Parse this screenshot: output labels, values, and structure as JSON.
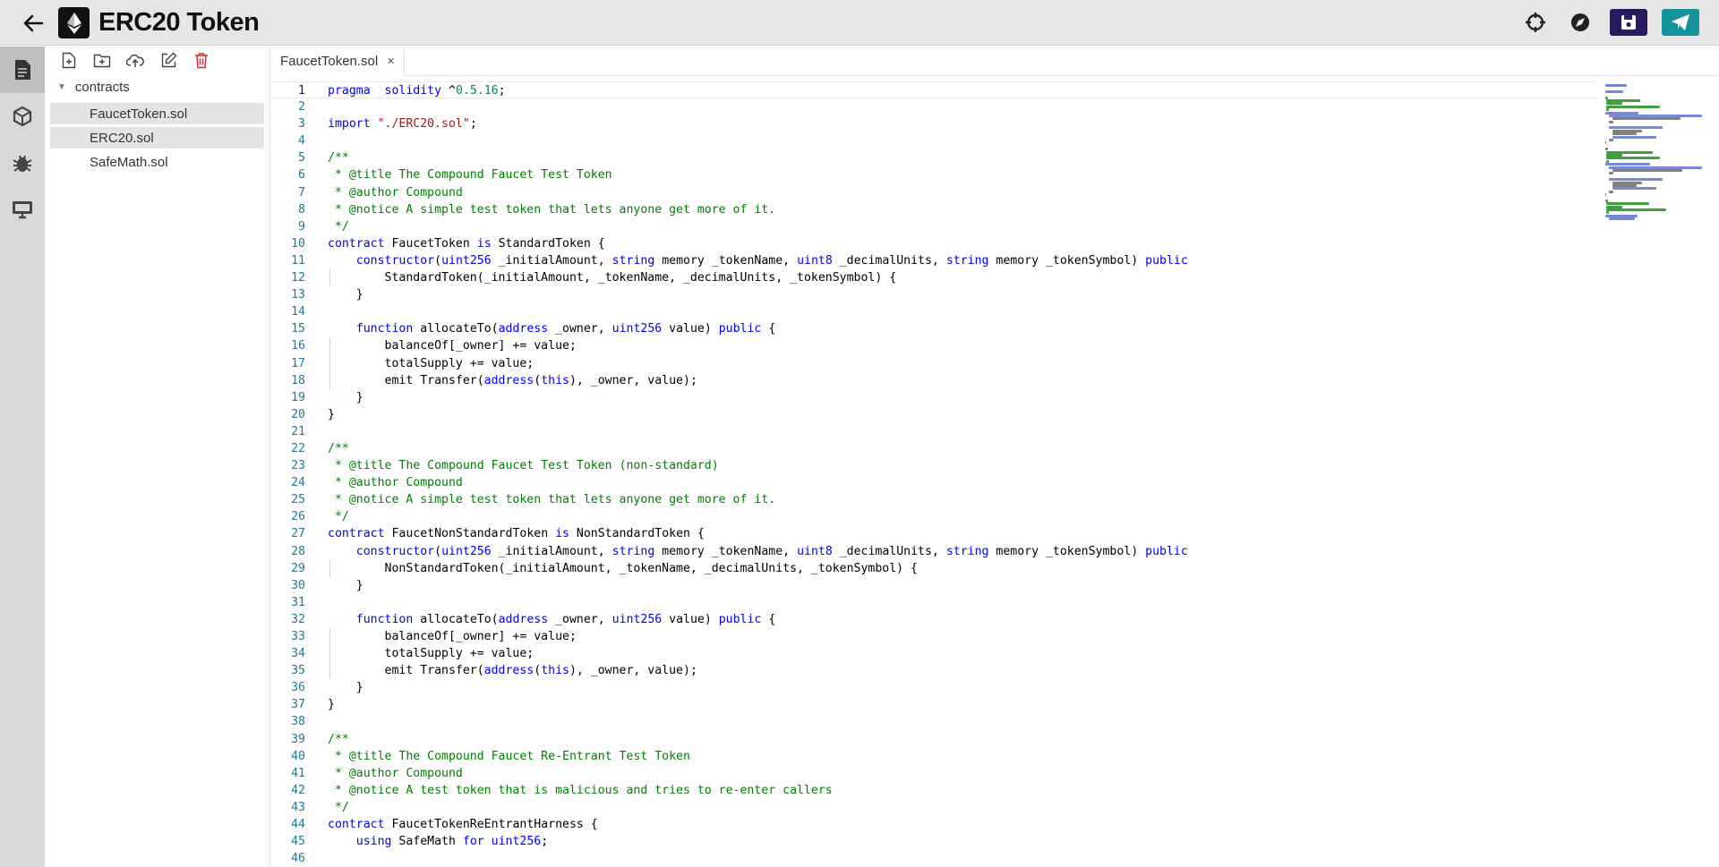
{
  "app": {
    "title": "ERC20 Token"
  },
  "topbar": {
    "icons": [
      "back-arrow-icon",
      "ethereum-logo",
      "crosshair-icon",
      "compass-icon",
      "save-icon",
      "send-icon"
    ]
  },
  "rail": {
    "items": [
      "file-explorer-icon",
      "compiler-icon",
      "debugger-icon",
      "terminal-icon"
    ]
  },
  "explorer": {
    "toolbar": [
      "new-file-icon",
      "new-folder-icon",
      "upload-icon",
      "rename-icon",
      "delete-icon"
    ],
    "folder": "contracts",
    "files": [
      {
        "name": "FaucetToken.sol",
        "selected": true
      },
      {
        "name": "ERC20.sol",
        "selected": true
      },
      {
        "name": "SafeMath.sol",
        "selected": false
      }
    ]
  },
  "editor": {
    "tab": {
      "label": "FaucetToken.sol",
      "close": "×"
    },
    "lines": [
      [
        [
          "kw",
          "pragma"
        ],
        [
          "",
          "  "
        ],
        [
          "kw",
          "solidity"
        ],
        [
          "",
          " ^"
        ],
        [
          "num",
          "0.5.16"
        ],
        [
          "",
          ";"
        ]
      ],
      [],
      [
        [
          "kw",
          "import"
        ],
        [
          "",
          " "
        ],
        [
          "str",
          "\"./ERC20.sol\""
        ],
        [
          "",
          ";"
        ]
      ],
      [],
      [
        [
          "cm",
          "/**"
        ]
      ],
      [
        [
          "cm",
          " * @title The Compound Faucet Test Token"
        ]
      ],
      [
        [
          "cm",
          " * @author Compound"
        ]
      ],
      [
        [
          "cm",
          " * @notice A simple test token that lets anyone get more of it."
        ]
      ],
      [
        [
          "cm",
          " */"
        ]
      ],
      [
        [
          "kw",
          "contract"
        ],
        [
          "",
          " FaucetToken "
        ],
        [
          "kw",
          "is"
        ],
        [
          "",
          " StandardToken {"
        ]
      ],
      [
        [
          "",
          "    "
        ],
        [
          "kw",
          "constructor"
        ],
        [
          "",
          "("
        ],
        [
          "ty",
          "uint256"
        ],
        [
          "",
          " _initialAmount, "
        ],
        [
          "ty",
          "string"
        ],
        [
          "",
          " memory _tokenName, "
        ],
        [
          "ty",
          "uint8"
        ],
        [
          "",
          " _decimalUnits, "
        ],
        [
          "ty",
          "string"
        ],
        [
          "",
          " memory _tokenSymbol) "
        ],
        [
          "kw",
          "public"
        ]
      ],
      [
        [
          "",
          "        StandardToken(_initialAmount, _tokenName, _decimalUnits, _tokenSymbol) {"
        ]
      ],
      [
        [
          "",
          "    }"
        ]
      ],
      [],
      [
        [
          "",
          "    "
        ],
        [
          "kw",
          "function"
        ],
        [
          "",
          " allocateTo("
        ],
        [
          "ty",
          "address"
        ],
        [
          "",
          " _owner, "
        ],
        [
          "ty",
          "uint256"
        ],
        [
          "",
          " value) "
        ],
        [
          "kw",
          "public"
        ],
        [
          "",
          " {"
        ]
      ],
      [
        [
          "",
          "        balanceOf[_owner] += value;"
        ]
      ],
      [
        [
          "",
          "        totalSupply += value;"
        ]
      ],
      [
        [
          "",
          "        emit Transfer("
        ],
        [
          "ty",
          "address"
        ],
        [
          "",
          "("
        ],
        [
          "kw",
          "this"
        ],
        [
          "",
          "), _owner, value);"
        ]
      ],
      [
        [
          "",
          "    }"
        ]
      ],
      [
        [
          "",
          "}"
        ]
      ],
      [],
      [
        [
          "cm",
          "/**"
        ]
      ],
      [
        [
          "cm",
          " * @title The Compound Faucet Test Token (non-standard)"
        ]
      ],
      [
        [
          "cm",
          " * @author Compound"
        ]
      ],
      [
        [
          "cm",
          " * @notice A simple test token that lets anyone get more of it."
        ]
      ],
      [
        [
          "cm",
          " */"
        ]
      ],
      [
        [
          "kw",
          "contract"
        ],
        [
          "",
          " FaucetNonStandardToken "
        ],
        [
          "kw",
          "is"
        ],
        [
          "",
          " NonStandardToken {"
        ]
      ],
      [
        [
          "",
          "    "
        ],
        [
          "kw",
          "constructor"
        ],
        [
          "",
          "("
        ],
        [
          "ty",
          "uint256"
        ],
        [
          "",
          " _initialAmount, "
        ],
        [
          "ty",
          "string"
        ],
        [
          "",
          " memory _tokenName, "
        ],
        [
          "ty",
          "uint8"
        ],
        [
          "",
          " _decimalUnits, "
        ],
        [
          "ty",
          "string"
        ],
        [
          "",
          " memory _tokenSymbol) "
        ],
        [
          "kw",
          "public"
        ]
      ],
      [
        [
          "",
          "        NonStandardToken(_initialAmount, _tokenName, _decimalUnits, _tokenSymbol) {"
        ]
      ],
      [
        [
          "",
          "    }"
        ]
      ],
      [],
      [
        [
          "",
          "    "
        ],
        [
          "kw",
          "function"
        ],
        [
          "",
          " allocateTo("
        ],
        [
          "ty",
          "address"
        ],
        [
          "",
          " _owner, "
        ],
        [
          "ty",
          "uint256"
        ],
        [
          "",
          " value) "
        ],
        [
          "kw",
          "public"
        ],
        [
          "",
          " {"
        ]
      ],
      [
        [
          "",
          "        balanceOf[_owner] += value;"
        ]
      ],
      [
        [
          "",
          "        totalSupply += value;"
        ]
      ],
      [
        [
          "",
          "        emit Transfer("
        ],
        [
          "ty",
          "address"
        ],
        [
          "",
          "("
        ],
        [
          "kw",
          "this"
        ],
        [
          "",
          "), _owner, value);"
        ]
      ],
      [
        [
          "",
          "    }"
        ]
      ],
      [
        [
          "",
          "}"
        ]
      ],
      [],
      [
        [
          "cm",
          "/**"
        ]
      ],
      [
        [
          "cm",
          " * @title The Compound Faucet Re-Entrant Test Token"
        ]
      ],
      [
        [
          "cm",
          " * @author Compound"
        ]
      ],
      [
        [
          "cm",
          " * @notice A test token that is malicious and tries to re-enter callers"
        ]
      ],
      [
        [
          "cm",
          " */"
        ]
      ],
      [
        [
          "kw",
          "contract"
        ],
        [
          "",
          " FaucetTokenReEntrantHarness {"
        ]
      ],
      [
        [
          "",
          "    "
        ],
        [
          "kw",
          "using"
        ],
        [
          "",
          " SafeMath "
        ],
        [
          "kw",
          "for"
        ],
        [
          "",
          " "
        ],
        [
          "ty",
          "uint256"
        ],
        [
          "",
          ";"
        ]
      ],
      []
    ]
  },
  "colors": {
    "keyword": "#0000ff",
    "string": "#a31515",
    "comment": "#008000",
    "number": "#098658",
    "line_number": "#237893",
    "save_button": "#2a1a5e",
    "deploy_button": "#14939a"
  }
}
